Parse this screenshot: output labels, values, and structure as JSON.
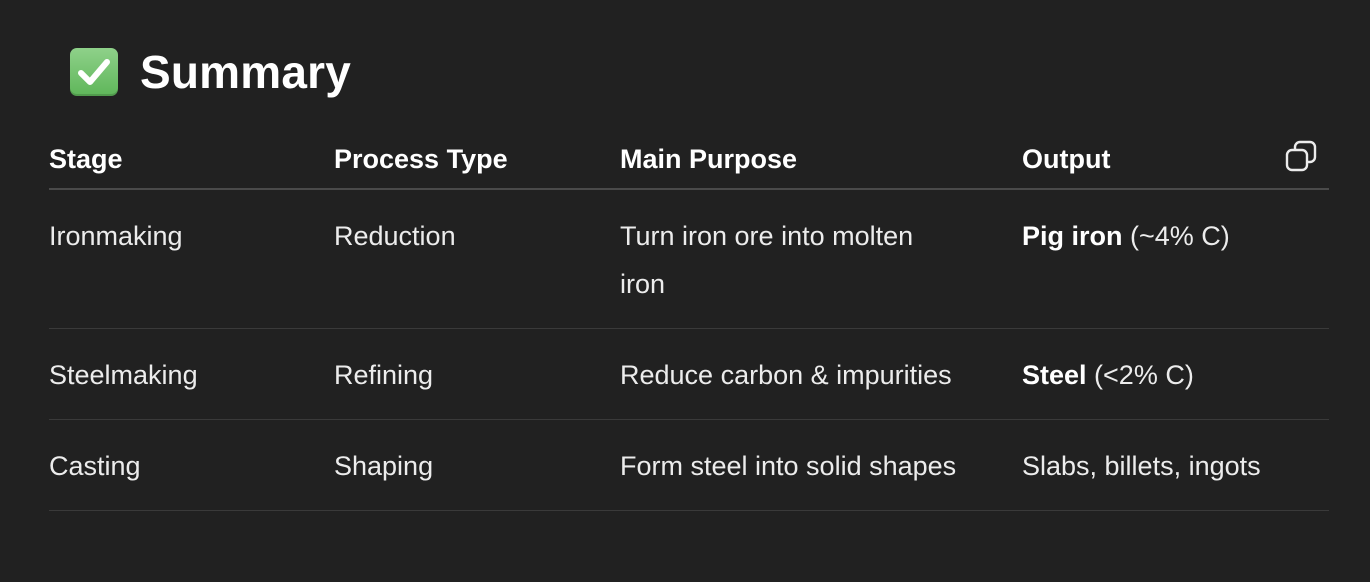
{
  "heading": {
    "icon": "check-mark-button-icon",
    "title": "Summary"
  },
  "table": {
    "copy_icon": "copy-icon",
    "columns": [
      "Stage",
      "Process Type",
      "Main Purpose",
      "Output"
    ],
    "rows": [
      {
        "stage": "Ironmaking",
        "process_type": "Reduction",
        "main_purpose": "Turn iron ore into molten iron",
        "output_bold": "Pig iron",
        "output_rest": " (~4% C)"
      },
      {
        "stage": "Steelmaking",
        "process_type": "Refining",
        "main_purpose": "Reduce carbon & impurities",
        "output_bold": "Steel",
        "output_rest": " (<2% C)"
      },
      {
        "stage": "Casting",
        "process_type": "Shaping",
        "main_purpose": "Form steel into solid shapes",
        "output_bold": "",
        "output_rest": "Slabs, billets, ingots"
      }
    ]
  }
}
